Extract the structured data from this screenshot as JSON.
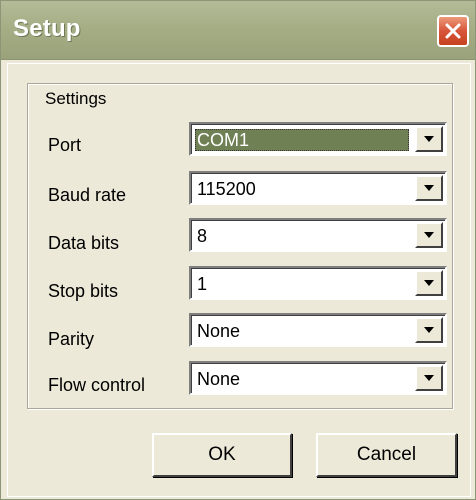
{
  "window": {
    "title": "Setup",
    "close_icon": "close-x-icon"
  },
  "settings": {
    "group_label": "Settings",
    "fields": [
      {
        "label": "Port",
        "value": "COM1",
        "selected": true
      },
      {
        "label": "Baud rate",
        "value": "115200",
        "selected": false
      },
      {
        "label": "Data bits",
        "value": "8",
        "selected": false
      },
      {
        "label": "Stop bits",
        "value": "1",
        "selected": false
      },
      {
        "label": "Parity",
        "value": "None",
        "selected": false
      },
      {
        "label": "Flow control",
        "value": "None",
        "selected": false
      }
    ]
  },
  "buttons": {
    "ok": "OK",
    "cancel": "Cancel"
  },
  "colors": {
    "titlebar": "#a5ae85",
    "close_button": "#d8553a",
    "selection": "#6f8055",
    "dialog_face": "#ece9d8"
  }
}
